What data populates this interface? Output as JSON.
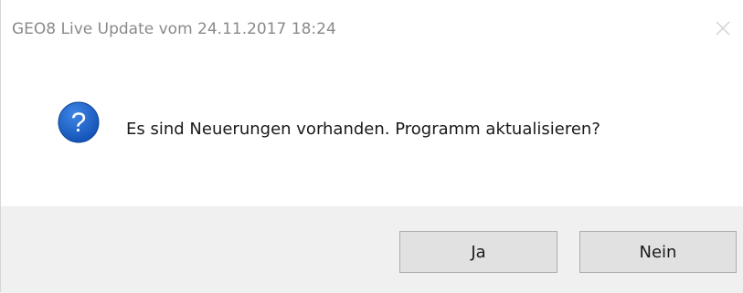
{
  "window": {
    "title": "GEO8 Live Update vom 24.11.2017 18:24",
    "close_icon": "close-icon"
  },
  "content": {
    "icon": "question-icon",
    "icon_color": "#1c5ec8",
    "message": "Es sind Neuerungen vorhanden. Programm aktualisieren?"
  },
  "buttons": {
    "yes_label": "Ja",
    "no_label": "Nein"
  },
  "colors": {
    "footer_background": "#f0f0f0",
    "button_background": "#e1e1e1",
    "button_border": "#adadad",
    "title_text": "#8a8a8a"
  }
}
